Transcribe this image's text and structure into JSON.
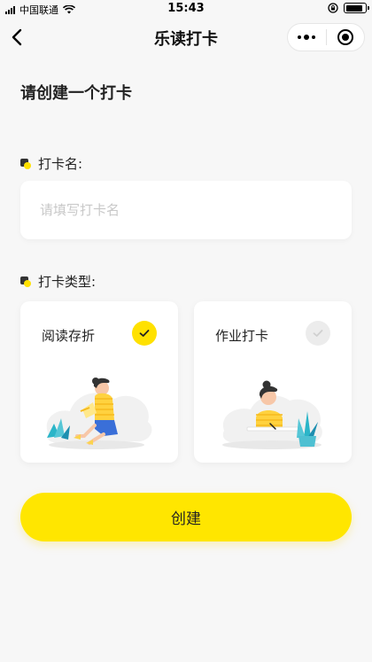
{
  "status_bar": {
    "carrier": "中国联通",
    "time": "15:43",
    "battery_level": 0.9
  },
  "nav": {
    "title": "乐读打卡",
    "back_icon": "chevron-left-icon",
    "more_icon": "more-dots-icon",
    "close_icon": "target-circle-icon"
  },
  "page": {
    "heading": "请创建一个打卡"
  },
  "name_section": {
    "label": "打卡名:",
    "input_value": "",
    "placeholder": "请填写打卡名"
  },
  "type_section": {
    "label": "打卡类型:",
    "cards": [
      {
        "title": "阅读存折",
        "selected": true,
        "icon": "check-icon",
        "illustration": "reading-girl-illustration"
      },
      {
        "title": "作业打卡",
        "selected": false,
        "icon": "check-icon",
        "illustration": "homework-girl-illustration"
      }
    ]
  },
  "actions": {
    "create_label": "创建"
  },
  "colors": {
    "accent": "#ffe600",
    "selected_check": "#ffe100",
    "unselected_check": "#ececec",
    "background": "#f7f7f7"
  }
}
